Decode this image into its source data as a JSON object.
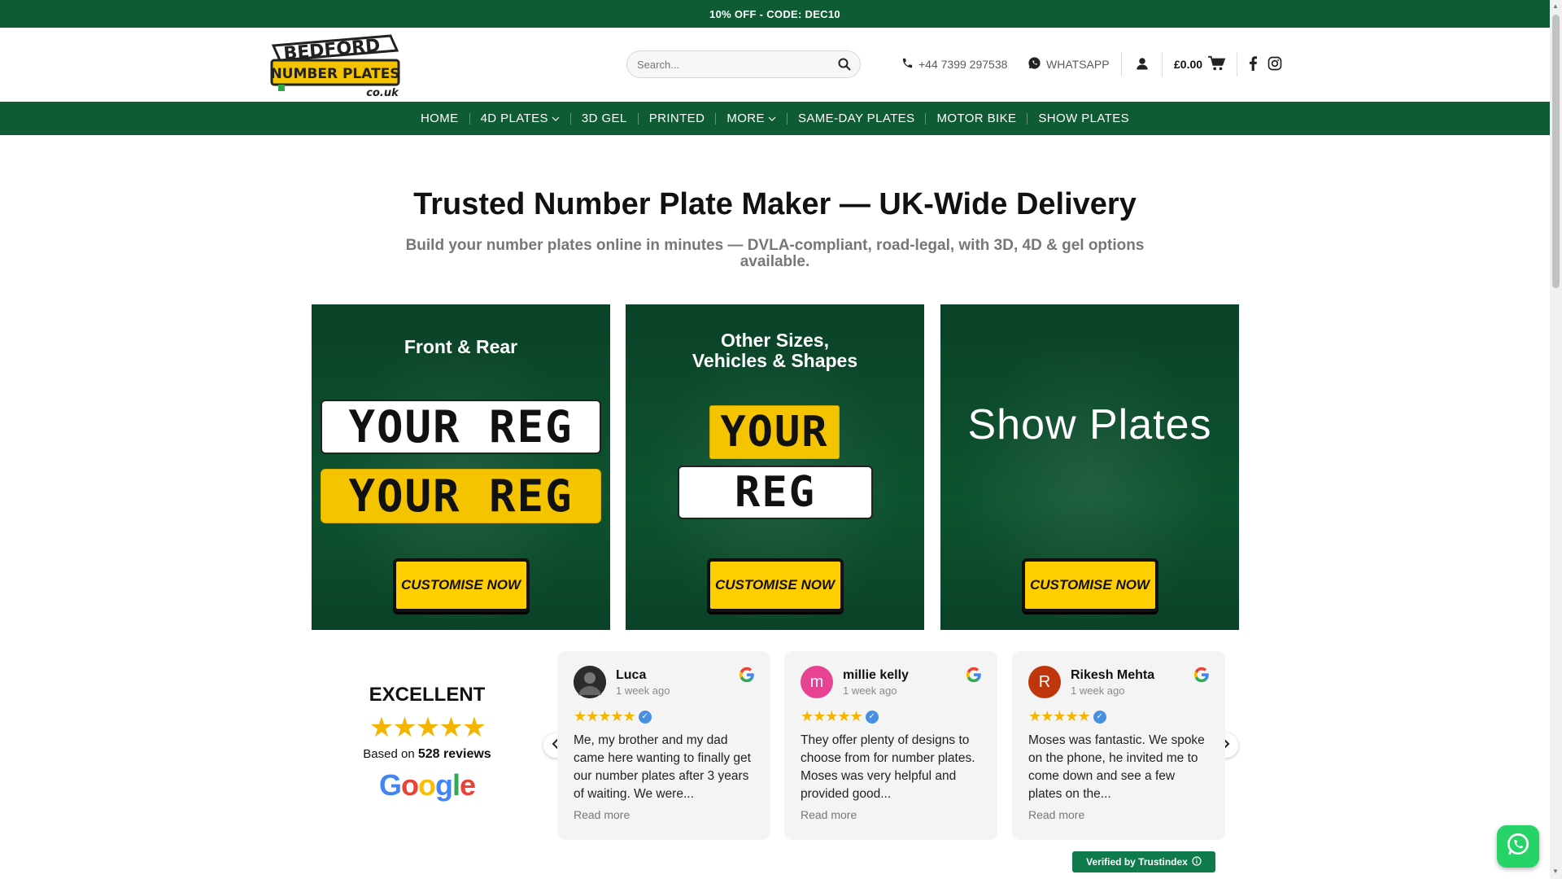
{
  "promo": {
    "text": "10% OFF - CODE: DEC10"
  },
  "header": {
    "logo": {
      "line1": "BEDFORD",
      "line2": "NUMBER PLATES",
      "line3": "co.uk"
    },
    "search_placeholder": "Search...",
    "phone": "+44 7399 297538",
    "whatsapp": "WHATSAPP",
    "cart_total": "£0.00"
  },
  "nav": {
    "items": [
      {
        "label": "HOME"
      },
      {
        "label": "4D PLATES",
        "has_dropdown": true
      },
      {
        "label": "3D GEL"
      },
      {
        "label": "PRINTED"
      },
      {
        "label": "MORE",
        "has_dropdown": true
      },
      {
        "label": "SAME-DAY PLATES"
      },
      {
        "label": "MOTOR BIKE"
      },
      {
        "label": "SHOW PLATES"
      }
    ]
  },
  "hero": {
    "title": "Trusted Number Plate Maker — UK-Wide Delivery",
    "subtitle": "Build your number plates online in minutes — DVLA-compliant, road-legal, with 3D, 4D & gel options available."
  },
  "cards": [
    {
      "title": "Front & Rear",
      "plate_top": "YOUR REG",
      "plate_bottom": "YOUR REG",
      "cta": "CUSTOMISE NOW"
    },
    {
      "title_line1": "Other Sizes,",
      "title_line2": "Vehicles & Shapes",
      "plate_top": "YOUR",
      "plate_bottom": "REG",
      "cta": "CUSTOMISE NOW"
    },
    {
      "title": "Show Plates",
      "cta": "CUSTOMISE NOW"
    }
  ],
  "reviews_summary": {
    "rating_word": "EXCELLENT",
    "stars": "★★★★★",
    "based_on": "Based on",
    "count": "528 reviews",
    "brand": "Google"
  },
  "reviews": [
    {
      "name": "Luca",
      "time": "1 week ago",
      "avatar": "",
      "avatar_color": "#444444",
      "text": "Me, my brother and my dad came here wanting to finally get our number plates after 3 years of waiting. We were...",
      "more": "Read more"
    },
    {
      "name": "millie kelly",
      "time": "1 week ago",
      "avatar": "m",
      "avatar_color": "#e84393",
      "text": "They offer plenty of designs to choose from for number plates. Moses was very helpful and provided good...",
      "more": "Read more"
    },
    {
      "name": "Rikesh Mehta",
      "time": "1 week ago",
      "avatar": "R",
      "avatar_color": "#bf360c",
      "text": "Moses was fantastic. We spoke on the phone, he invited me to come down and see a few plates on the...",
      "more": "Read more"
    }
  ],
  "verified": {
    "text": "Verified by Trustindex"
  },
  "colors": {
    "brand_green": "#0f5b34",
    "plate_yellow": "#f5c400",
    "cta_yellow": "#ffce00",
    "star": "#f5b400"
  }
}
